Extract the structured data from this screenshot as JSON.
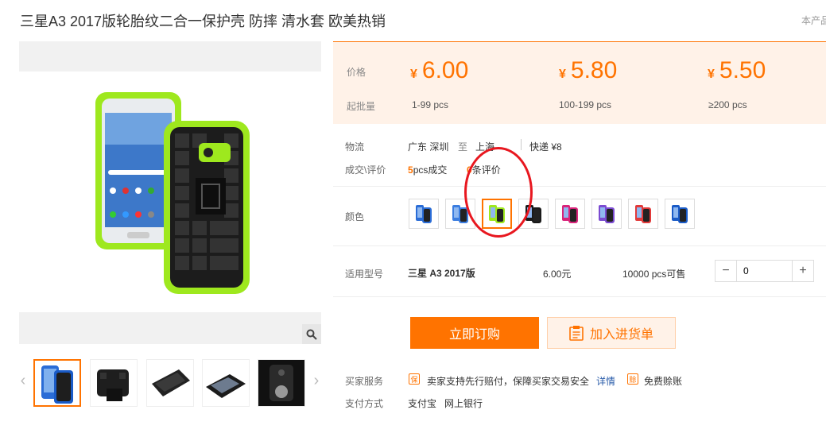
{
  "product": {
    "title": "三星A3 2017版轮胎纹二合一保护壳 防摔 清水套 欧美热销",
    "top_right": "本产品"
  },
  "price_box": {
    "price_label": "价格",
    "moq_label": "起批量",
    "tiers": [
      {
        "currency": "¥",
        "price": "6.00",
        "range": "1-99 pcs"
      },
      {
        "currency": "¥",
        "price": "5.80",
        "range": "100-199 pcs"
      },
      {
        "currency": "¥",
        "price": "5.50",
        "range": "≥200 pcs"
      }
    ]
  },
  "logistics": {
    "label": "物流",
    "from": "广东 深圳",
    "to_word": "至",
    "to": "上海",
    "express": "快递 ¥8"
  },
  "deals": {
    "label": "成交\\评价",
    "sold_count": "5",
    "sold_suffix": "pcs成交",
    "review_count": "0",
    "review_suffix": "条评价"
  },
  "color": {
    "label": "颜色",
    "selected_index": 2
  },
  "model_row": {
    "label": "适用型号",
    "model": "三星 A3 2017版",
    "price": "6.00元",
    "stock": "10000 pcs可售",
    "minus": "−",
    "quantity": "0",
    "plus": "+"
  },
  "actions": {
    "buy_now": "立即订购",
    "add_to_cart": "加入进货单"
  },
  "services": {
    "label": "买家服务",
    "guarantee_icon": "保",
    "guarantee_text": "卖家支持先行赔付，保障买家交易安全",
    "details_link": "详情",
    "free_return_icon": "赊",
    "free_return_text": "免费赊账"
  },
  "payment": {
    "label": "支付方式",
    "methods": [
      "支付宝",
      "网上银行"
    ]
  },
  "gallery": {
    "prev": "‹",
    "next": "›"
  },
  "colors": {
    "accent": "#ff7300",
    "lime": "#9ee81e",
    "annotation": "#e8171f"
  }
}
